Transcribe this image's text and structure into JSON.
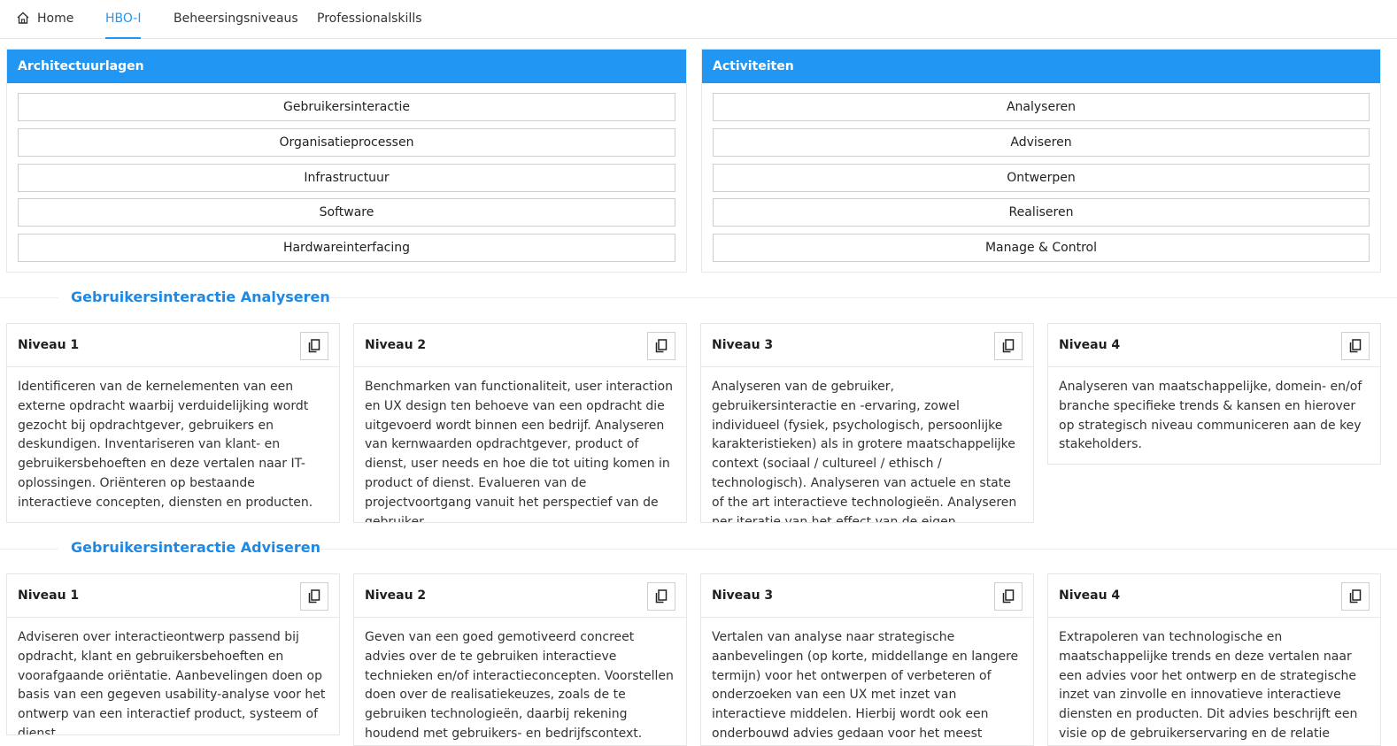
{
  "nav": {
    "home": "Home",
    "tabs": [
      "HBO-I",
      "Beheersingsniveaus",
      "Professionalskills"
    ],
    "active_tab": "HBO-I"
  },
  "architectuurlagen": {
    "title": "Architectuurlagen",
    "items": [
      "Gebruikersinteractie",
      "Organisatieprocessen",
      "Infrastructuur",
      "Software",
      "Hardwareinterfacing"
    ]
  },
  "activiteiten": {
    "title": "Activiteiten",
    "items": [
      "Analyseren",
      "Adviseren",
      "Ontwerpen",
      "Realiseren",
      "Manage & Control"
    ]
  },
  "sections": [
    {
      "title": "Gebruikersinteractie Analyseren",
      "levels": [
        {
          "title": "Niveau 1",
          "text": "Identificeren van de kernelementen van een externe opdracht waarbij verduidelijking wordt gezocht bij opdrachtgever, gebruikers en deskundigen. Inventariseren van klant- en gebruikersbehoeften en deze vertalen naar IT-oplossingen. Oriënteren op bestaande interactieve concepten, diensten en producten."
        },
        {
          "title": "Niveau 2",
          "text": "Benchmarken van functionaliteit, user interaction en UX design ten behoeve van een opdracht die uitgevoerd wordt binnen een bedrijf. Analyseren van kernwaarden opdrachtgever, product of dienst, user needs en hoe die tot uiting komen in product of dienst. Evalueren van de projectvoortgang vanuit het perspectief van de gebruiker."
        },
        {
          "title": "Niveau 3",
          "text": "Analyseren van de gebruiker, gebruikersinteractie en -ervaring, zowel individueel (fysiek, psychologisch, persoonlijke karakteristieken) als in grotere maatschappelijke context (sociaal / cultureel / ethisch / technologisch). Analyseren van actuele en state of the art interactieve technologieën. Analyseren per iteratie van het effect van de eigen interventie op/in de UX."
        },
        {
          "title": "Niveau 4",
          "text": "Analyseren van maatschappelijke, domein- en/of branche specifieke trends & kansen en hierover op strategisch niveau communiceren aan de key stakeholders."
        }
      ]
    },
    {
      "title": "Gebruikersinteractie Adviseren",
      "levels": [
        {
          "title": "Niveau 1",
          "text": "Adviseren over interactieontwerp passend bij opdracht, klant en gebruikersbehoeften en voorafgaande oriëntatie. Aanbevelingen doen op basis van een gegeven usability-analyse voor het ontwerp van een interactief product, systeem of dienst."
        },
        {
          "title": "Niveau 2",
          "text": "Geven van een goed gemotiveerd concreet advies over de te gebruiken interactieve technieken en/of interactieconcepten. Voorstellen doen over de realisatiekeuzes, zoals de te gebruiken technologieën, daarbij rekening houdend met gebruikers- en bedrijfscontext. Adviseren over de doelstellingen van de"
        },
        {
          "title": "Niveau 3",
          "text": "Vertalen van analyse naar strategische aanbevelingen (op korte, middellange en langere termijn) voor het ontwerpen of verbeteren of onderzoeken van een UX met inzet van interactieve middelen. Hierbij wordt ook een onderbouwd advies gedaan voor het meest geschikte ontwerpproces (bijvoorbeeld UCD)."
        },
        {
          "title": "Niveau 4",
          "text": "Extrapoleren van technologische en maatschappelijke trends en deze vertalen naar een advies voor het ontwerp en de strategische inzet van zinvolle en innovatieve interactieve diensten en producten. Dit advies beschrijft een visie op de gebruikerservaring en de relatie tussen gebruiker en product/dienst."
        }
      ]
    }
  ],
  "icons": {
    "home": "home-icon",
    "copy": "copy-icon"
  },
  "colors": {
    "primary": "#2196f3",
    "section_title": "#1e88e5"
  }
}
